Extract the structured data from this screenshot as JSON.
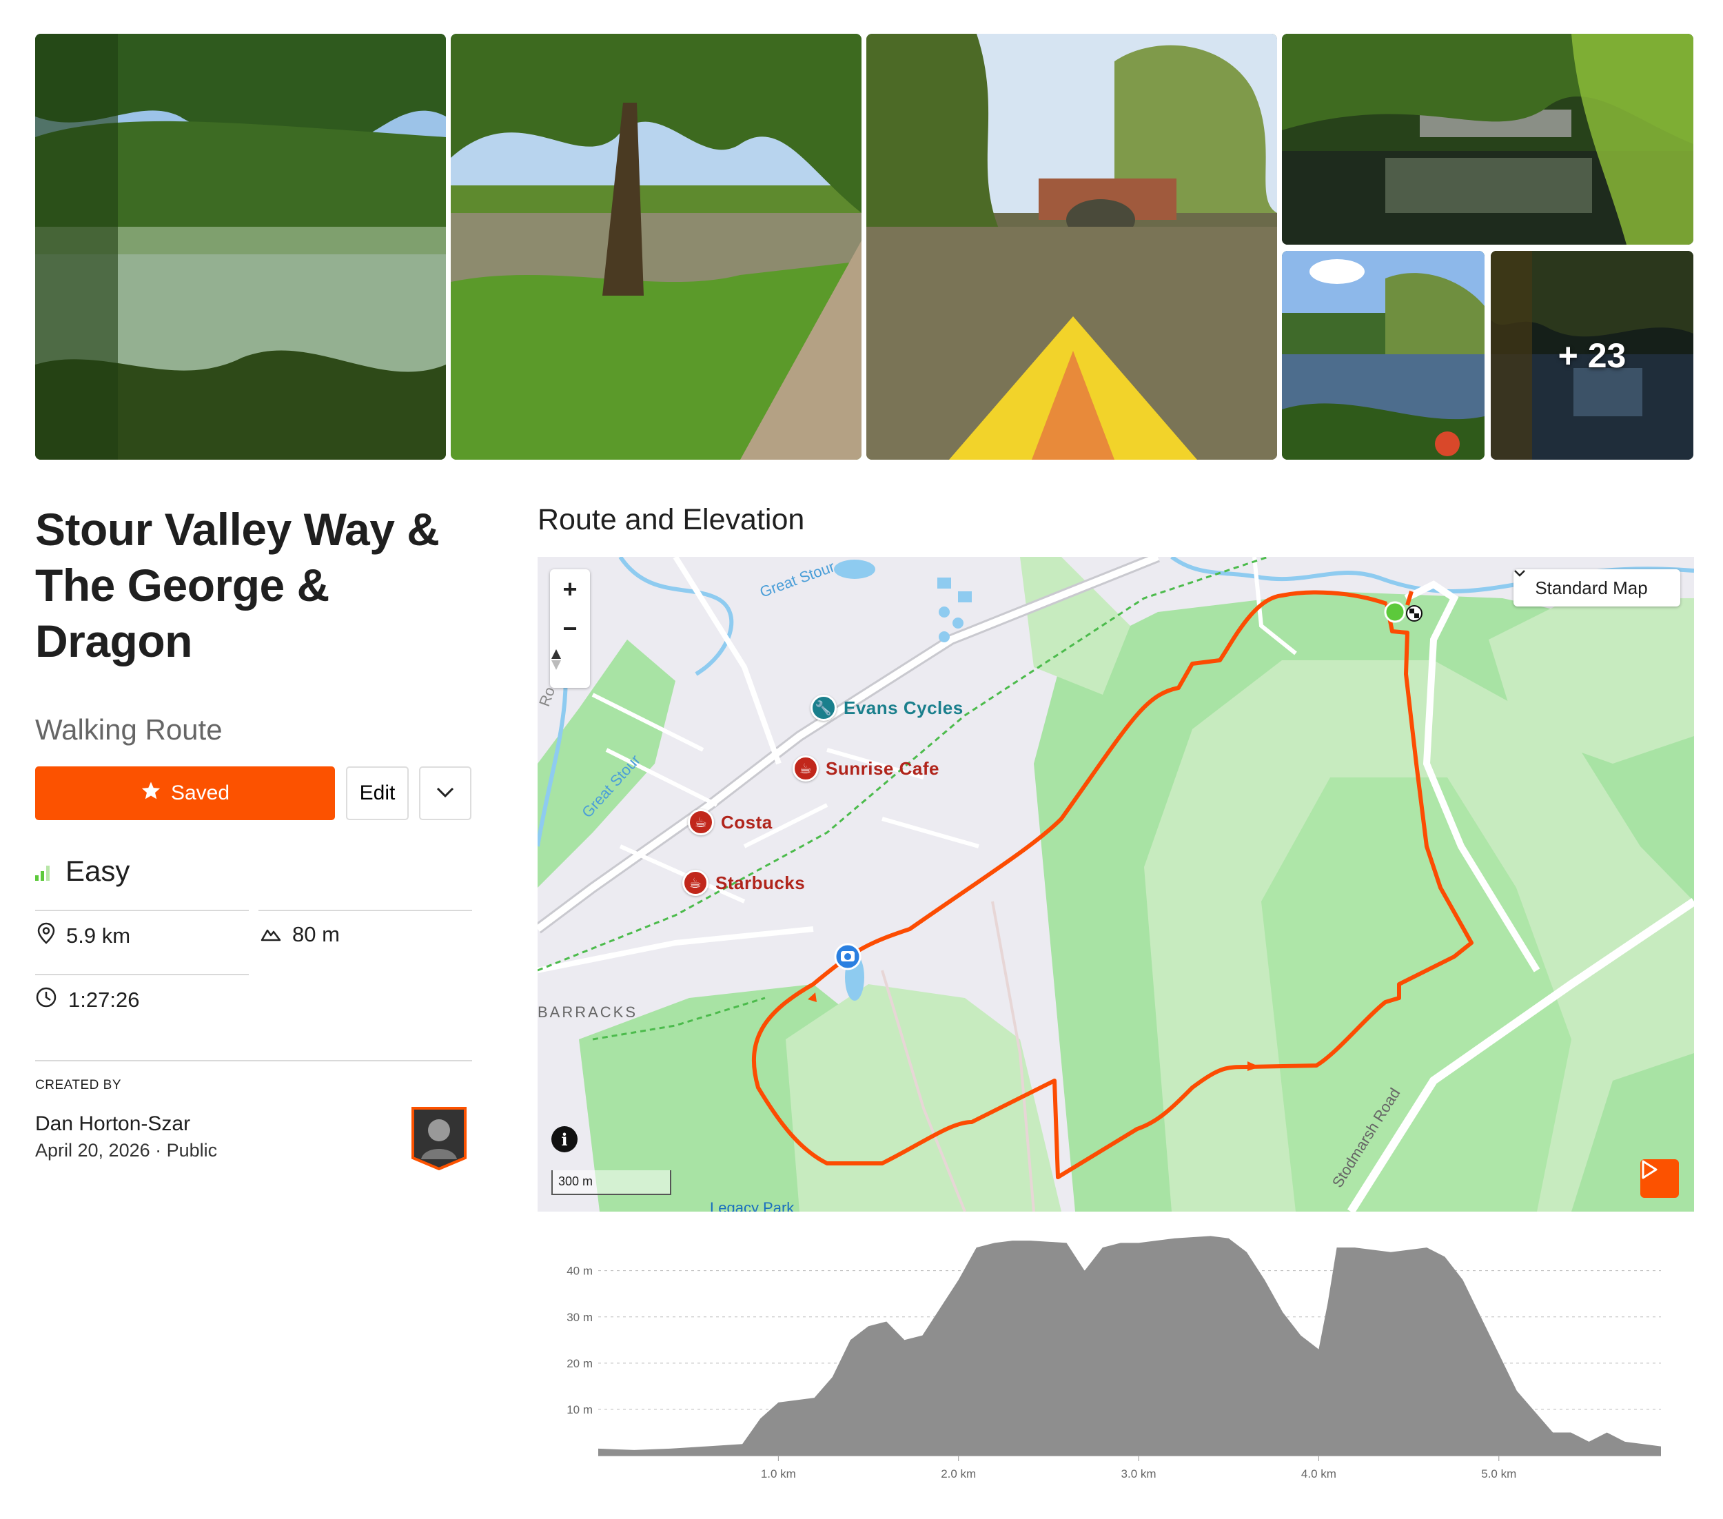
{
  "gallery": {
    "more_count": "+ 23"
  },
  "route": {
    "title": "Stour Valley Way & The George & Dragon",
    "type": "Walking Route",
    "saved_label": "Saved",
    "edit_label": "Edit",
    "difficulty": "Easy",
    "distance": "5.9 km",
    "elevation_gain": "80 m",
    "duration": "1:27:26"
  },
  "creator": {
    "label": "CREATED BY",
    "name": "Dan Horton-Szar",
    "date": "April 20, 2026",
    "visibility": "Public"
  },
  "map": {
    "section_title": "Route and Elevation",
    "map_type": "Standard Map",
    "scale": "300 m",
    "pois": [
      {
        "name": "Evans Cycles",
        "kind": "bike-shop"
      },
      {
        "name": "Sunrise Cafe",
        "kind": "cafe"
      },
      {
        "name": "Costa",
        "kind": "cafe"
      },
      {
        "name": "Starbucks",
        "kind": "cafe"
      }
    ],
    "labels": {
      "river1": "Great Stour",
      "river2": "Great Stour",
      "barracks": "BARRACKS",
      "road": "Stodmarsh Road",
      "ro": "Ro",
      "park": "Legacy Park"
    },
    "colors": {
      "route": "#fc4c02",
      "start": "#5cc93b",
      "poi": "#c1271b",
      "bike": "#1a7f8c"
    }
  },
  "chart_data": {
    "type": "area",
    "xlabel": "",
    "ylabel": "",
    "x_ticks": [
      "1.0 km",
      "2.0 km",
      "3.0 km",
      "4.0 km",
      "5.0 km"
    ],
    "y_ticks": [
      "10 m",
      "20 m",
      "30 m",
      "40 m"
    ],
    "xlim": [
      0,
      5.9
    ],
    "ylim": [
      0,
      48
    ],
    "x": [
      0,
      0.2,
      0.4,
      0.6,
      0.8,
      0.9,
      1.0,
      1.2,
      1.3,
      1.4,
      1.5,
      1.6,
      1.7,
      1.8,
      1.9,
      2.0,
      2.1,
      2.2,
      2.3,
      2.4,
      2.6,
      2.7,
      2.8,
      2.9,
      3.0,
      3.2,
      3.4,
      3.5,
      3.6,
      3.7,
      3.8,
      3.9,
      4.0,
      4.05,
      4.1,
      4.2,
      4.4,
      4.6,
      4.7,
      4.8,
      4.9,
      5.0,
      5.1,
      5.3,
      5.4,
      5.5,
      5.6,
      5.7,
      5.9
    ],
    "values": [
      1.5,
      1.2,
      1.5,
      2,
      2.5,
      8,
      11.5,
      12.5,
      17,
      25,
      28,
      29,
      25,
      26,
      32,
      38,
      45,
      46,
      46.5,
      46.5,
      46,
      40,
      45,
      46,
      46,
      47,
      47.5,
      47,
      44,
      38,
      31,
      26,
      23,
      33,
      45,
      45,
      44,
      45,
      43,
      38,
      30,
      22,
      14,
      5,
      5,
      3,
      5,
      3,
      2
    ]
  }
}
